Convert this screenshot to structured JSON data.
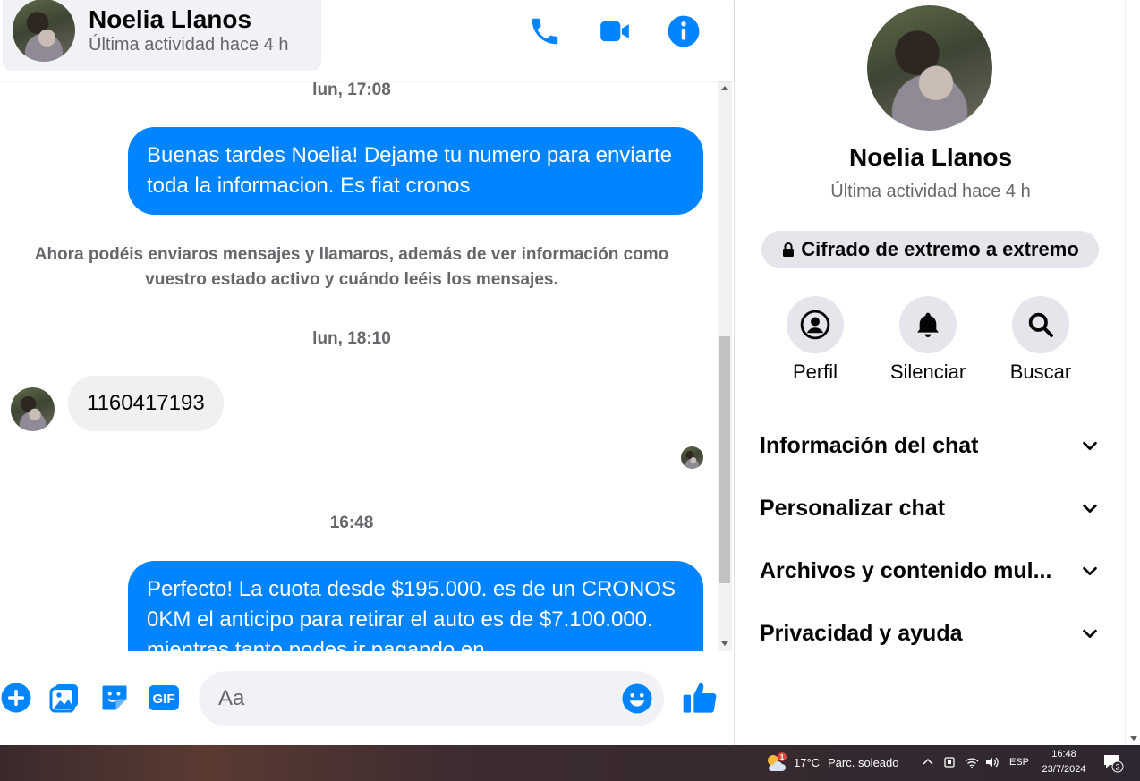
{
  "colors": {
    "accent": "#0084ff",
    "bubble_in": "#f0f0f0",
    "muted_text": "#65676b",
    "panel_bg": "#f0f2f5"
  },
  "header": {
    "name": "Noelia Llanos",
    "status": "Última actividad hace 4 h",
    "icons": [
      "phone-icon",
      "video-camera-icon",
      "info-icon"
    ]
  },
  "messages": [
    {
      "type": "time",
      "text": "lun, 17:08"
    },
    {
      "type": "outgoing",
      "text": "Buenas tardes Noelia! Dejame tu numero para enviarte toda la informacion. Es fiat cronos"
    },
    {
      "type": "system",
      "text": "Ahora podéis enviaros mensajes y llamaros, además de ver información como vuestro estado activo y cuándo leéis los mensajes."
    },
    {
      "type": "time",
      "text": "lun, 18:10"
    },
    {
      "type": "incoming",
      "text": "1160417193"
    },
    {
      "type": "time",
      "text": "16:48"
    },
    {
      "type": "outgoing",
      "text": "Perfecto! La cuota desde $195.000. es de un CRONOS 0KM el anticipo para retirar el auto es de $7.100.000. mientras tanto podes ir pagando en"
    }
  ],
  "composer": {
    "placeholder": "Aa",
    "icons": [
      "add-icon",
      "image-icon",
      "sticker-icon",
      "gif-icon",
      "emoji-icon",
      "thumbs-up-icon"
    ],
    "gif_label": "GIF"
  },
  "side": {
    "name": "Noelia Llanos",
    "status": "Última actividad hace 4 h",
    "encryption": "Cifrado de extremo a extremo",
    "actions": [
      {
        "label": "Perfil",
        "icon": "profile-icon"
      },
      {
        "label": "Silenciar",
        "icon": "bell-icon"
      },
      {
        "label": "Buscar",
        "icon": "search-icon"
      }
    ],
    "sections": [
      "Información del chat",
      "Personalizar chat",
      "Archivos y contenido mul...",
      "Privacidad y ayuda"
    ]
  },
  "taskbar": {
    "weather_temp": "17°C",
    "weather_desc": "Parc. soleado",
    "weather_badge": "1",
    "language": "ESP",
    "time": "16:48",
    "date": "23/7/2024",
    "notification_count": "2"
  }
}
